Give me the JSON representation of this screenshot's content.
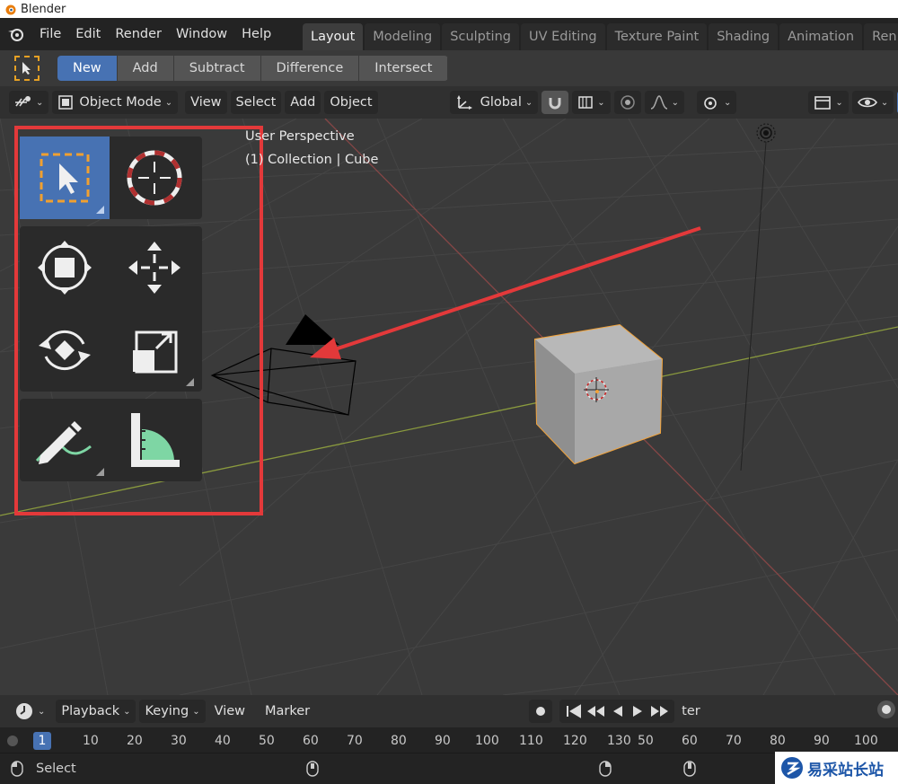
{
  "window": {
    "title": "Blender"
  },
  "menu": [
    "File",
    "Edit",
    "Render",
    "Window",
    "Help"
  ],
  "workspaces": [
    "Layout",
    "Modeling",
    "Sculpting",
    "UV Editing",
    "Texture Paint",
    "Shading",
    "Animation",
    "Ren"
  ],
  "active_workspace": "Layout",
  "tool_settings": {
    "mode_buttons": [
      "New",
      "Add",
      "Subtract",
      "Difference",
      "Intersect"
    ],
    "active": "New"
  },
  "viewport_header": {
    "mode": "Object Mode",
    "menus": [
      "View",
      "Select",
      "Add",
      "Object"
    ],
    "orientation": "Global"
  },
  "viewport": {
    "info_line1": "User Perspective",
    "info_line2": "(1) Collection | Cube",
    "accent_color": "#4772b3",
    "highlight_box_color": "#e3393a",
    "selected_outline_color": "#f2a33a"
  },
  "toolbar": {
    "tools": [
      "select-box",
      "cursor",
      "transform",
      "move",
      "rotate",
      "scale",
      "annotate",
      "measure"
    ],
    "active": "select-box"
  },
  "timeline": {
    "menus": [
      "Playback",
      "Keying",
      "View",
      "Marker"
    ],
    "current_frame": "1",
    "ticks_left": [
      "10",
      "20",
      "30",
      "40",
      "50",
      "60",
      "70",
      "80",
      "90",
      "100",
      "110",
      "120",
      "130"
    ],
    "ticks_right": [
      "50",
      "60",
      "70",
      "80",
      "90",
      "100"
    ],
    "overlap_text": "ter"
  },
  "statusbar": {
    "left_action": "Select"
  },
  "watermark": {
    "text": "易采站长站"
  }
}
